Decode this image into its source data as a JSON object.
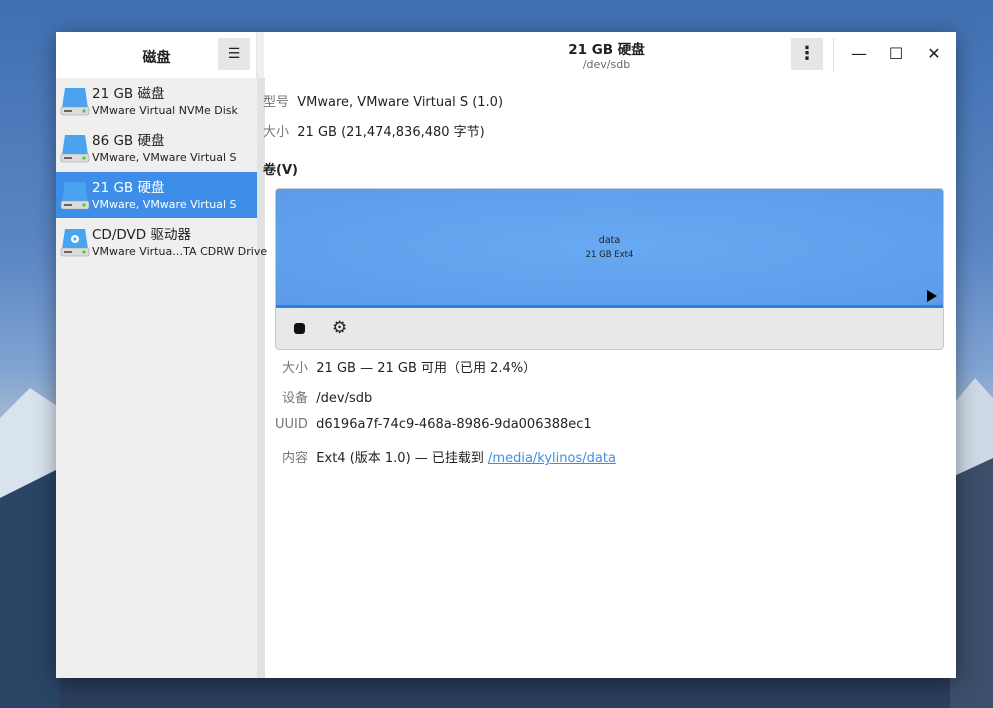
{
  "sidebar": {
    "title": "磁盘",
    "menu_icon": "hamburger-icon",
    "items": [
      {
        "title": "21 GB 磁盘",
        "subtitle": "VMware Virtual NVMe Disk"
      },
      {
        "title": "86 GB 硬盘",
        "subtitle": "VMware, VMware Virtual S"
      },
      {
        "title": "21 GB 硬盘",
        "subtitle": "VMware, VMware Virtual S",
        "selected": true
      },
      {
        "title": "CD/DVD 驱动器",
        "subtitle": "VMware Virtua…TA CDRW Drive"
      }
    ]
  },
  "header": {
    "title": "21 GB 硬盘",
    "subtitle": "/dev/sdb",
    "menu": "⋮",
    "minimize": "—",
    "maximize": "☐",
    "close": "✕"
  },
  "disk": {
    "model_label": "型号",
    "model": "VMware, VMware Virtual S (1.0)",
    "size_label": "大小",
    "size": "21 GB (21,474,836,480 字节)"
  },
  "volumes": {
    "heading": "卷(V)",
    "partition": {
      "name": "data",
      "desc": "21 GB Ext4"
    }
  },
  "details": {
    "size_label": "大小",
    "size": "21 GB — 21 GB 可用（已用 2.4%）",
    "device_label": "设备",
    "device": "/dev/sdb",
    "uuid_label": "UUID",
    "uuid": "d6196a7f-74c9-468a-8986-9da006388ec1",
    "contents_label": "内容",
    "contents": "Ext4 (版本 1.0) — 已挂载到 ",
    "mount_link": "/media/kylinos/data"
  }
}
